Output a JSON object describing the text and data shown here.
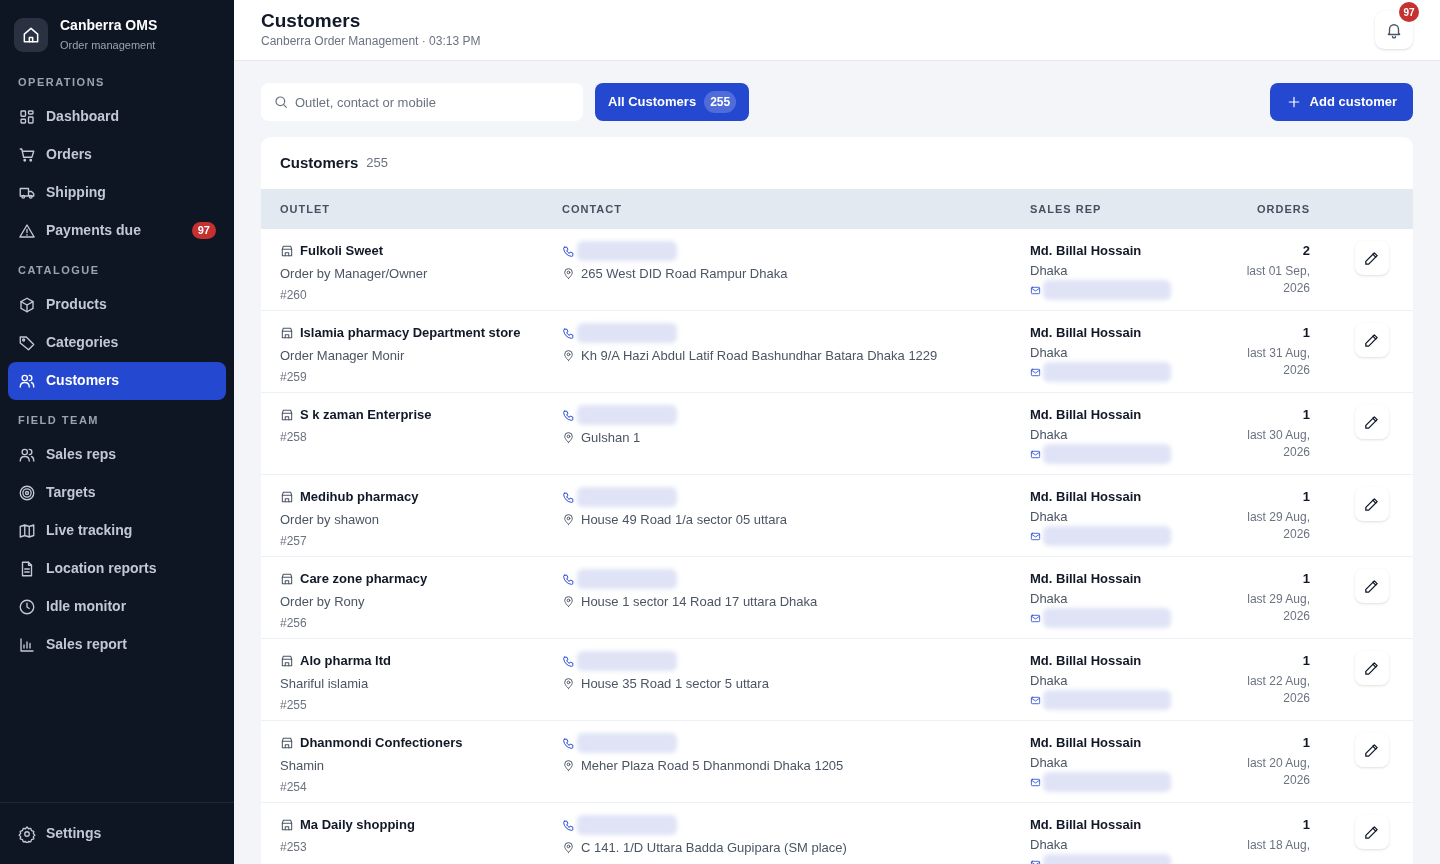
{
  "sidebar": {
    "brand": {
      "title": "Canberra OMS",
      "subtitle": "Order management"
    },
    "sections": [
      {
        "heading": "OPERATIONS",
        "items": [
          {
            "label": "Dashboard",
            "selected": false
          },
          {
            "label": "Orders",
            "selected": false
          },
          {
            "label": "Shipping",
            "selected": false
          },
          {
            "label": "Payments due",
            "selected": false,
            "badge": "97"
          }
        ]
      },
      {
        "heading": "CATALOGUE",
        "items": [
          {
            "label": "Products",
            "selected": false
          },
          {
            "label": "Categories",
            "selected": false
          },
          {
            "label": "Customers",
            "selected": true
          }
        ]
      },
      {
        "heading": "FIELD TEAM",
        "items": [
          {
            "label": "Sales reps",
            "selected": false
          },
          {
            "label": "Targets",
            "selected": false
          },
          {
            "label": "Live tracking",
            "selected": false
          },
          {
            "label": "Location reports",
            "selected": false
          },
          {
            "label": "Idle monitor",
            "selected": false
          },
          {
            "label": "Sales report",
            "selected": false
          }
        ]
      }
    ],
    "footer": {
      "label": "Settings"
    }
  },
  "header": {
    "title": "Customers",
    "subtitle": "Canberra Order Management · 03:13 PM",
    "notifications": "97"
  },
  "toolbar": {
    "search": {
      "placeholder": "Outlet, contact or mobile"
    },
    "filter": {
      "label": "All Customers",
      "count": "255",
      "selected": true
    },
    "add_button": "Add customer"
  },
  "table": {
    "title": "Customers",
    "count": "255",
    "columns": [
      "OUTLET",
      "CONTACT",
      "SALES REP",
      "ORDERS"
    ],
    "rows": [
      {
        "outlet": "Fulkoli Sweet",
        "note": "Order by Manager/Owner",
        "id": "#260",
        "address": "265 West DID Road Rampur Dhaka",
        "rep": "Md. Billal Hossain",
        "city": "Dhaka",
        "orders": "2",
        "last": "last 01 Sep, 2026"
      },
      {
        "outlet": "Islamia pharmacy Department store",
        "note": "Order Manager Monir",
        "id": "#259",
        "address": "Kh 9/A Hazi Abdul Latif Road Bashundhar Batara Dhaka 1229",
        "rep": "Md. Billal Hossain",
        "city": "Dhaka",
        "orders": "1",
        "last": "last 31 Aug, 2026"
      },
      {
        "outlet": "S k zaman Enterprise",
        "id": "#258",
        "address": "Gulshan 1",
        "rep": "Md. Billal Hossain",
        "city": "Dhaka",
        "orders": "1",
        "last": "last 30 Aug, 2026"
      },
      {
        "outlet": "Medihub pharmacy",
        "note": "Order by shawon",
        "id": "#257",
        "address": "House 49 Road 1/a sector 05 uttara",
        "rep": "Md. Billal Hossain",
        "city": "Dhaka",
        "orders": "1",
        "last": "last 29 Aug, 2026"
      },
      {
        "outlet": "Care zone pharmacy",
        "note": "Order by Rony",
        "id": "#256",
        "address": "House 1 sector 14 Road 17 uttara Dhaka",
        "rep": "Md. Billal Hossain",
        "city": "Dhaka",
        "orders": "1",
        "last": "last 29 Aug, 2026"
      },
      {
        "outlet": "Alo pharma ltd",
        "note": "Shariful islamia",
        "id": "#255",
        "address": "House 35 Road 1 sector 5 uttara",
        "rep": "Md. Billal Hossain",
        "city": "Dhaka",
        "orders": "1",
        "last": "last 22 Aug, 2026"
      },
      {
        "outlet": "Dhanmondi Confectioners",
        "note": "Shamin",
        "id": "#254",
        "address": "Meher Plaza Road 5 Dhanmondi Dhaka 1205",
        "rep": "Md. Billal Hossain",
        "city": "Dhaka",
        "orders": "1",
        "last": "last 20 Aug, 2026"
      },
      {
        "outlet": "Ma Daily shopping",
        "id": "#253",
        "address": "C 141. 1/D Uttara Badda Gupipara (SM place)",
        "rep": "Md. Billal Hossain",
        "city": "Dhaka",
        "orders": "1",
        "last": "last 18 Aug,"
      }
    ]
  }
}
